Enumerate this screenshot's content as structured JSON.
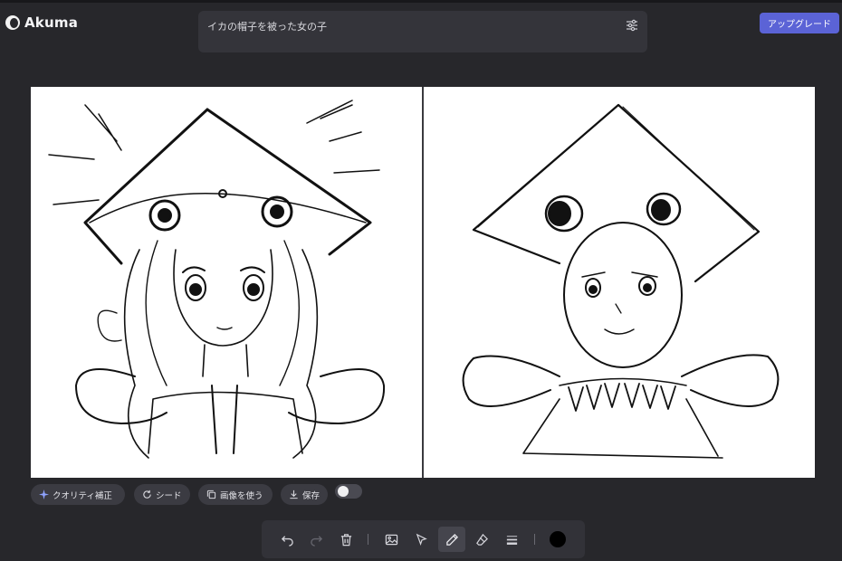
{
  "app": {
    "name": "Akuma"
  },
  "prompt": {
    "text": "イカの帽子を被った女の子"
  },
  "header": {
    "upgrade_label": "アップグレード"
  },
  "options": {
    "quality_label": "クオリティ補正",
    "seed_label": "シード",
    "use_image_label": "画像を使う",
    "save_label": "保存",
    "toggle_on": false
  },
  "toolbar": {
    "tools": [
      "undo-icon",
      "redo-icon",
      "trash-icon",
      "image-icon",
      "cursor-icon",
      "pencil-icon",
      "eraser-icon",
      "line-weight-icon"
    ],
    "active_tool": "pencil-icon",
    "brush_color": "#000000"
  },
  "colors": {
    "accent": "#5b63d6",
    "background": "#27272b"
  }
}
